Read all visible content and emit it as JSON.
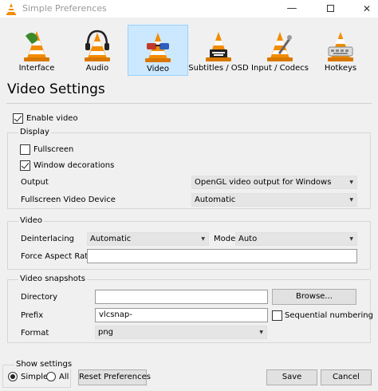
{
  "window": {
    "title": "Simple Preferences",
    "minimize": "—",
    "close": "✕"
  },
  "categories": [
    {
      "label": "Interface",
      "icon": "cone-interface-icon",
      "selected": false
    },
    {
      "label": "Audio",
      "icon": "cone-headphones-icon",
      "selected": false
    },
    {
      "label": "Video",
      "icon": "cone-glasses-icon",
      "selected": true
    },
    {
      "label": "Subtitles / OSD",
      "icon": "cone-subtitles-icon",
      "selected": false
    },
    {
      "label": "Input / Codecs",
      "icon": "cone-tools-icon",
      "selected": false
    },
    {
      "label": "Hotkeys",
      "icon": "cone-keyboard-icon",
      "selected": false
    }
  ],
  "page_title": "Video Settings",
  "enable_video": {
    "label": "Enable video",
    "checked": true
  },
  "display": {
    "title": "Display",
    "fullscreen": {
      "label": "Fullscreen",
      "checked": false
    },
    "window_decorations": {
      "label": "Window decorations",
      "checked": true
    },
    "output_label": "Output",
    "output_value": "OpenGL video output for Windows",
    "fs_device_label": "Fullscreen Video Device",
    "fs_device_value": "Automatic"
  },
  "video": {
    "title": "Video",
    "deinterlacing_label": "Deinterlacing",
    "deinterlacing_value": "Automatic",
    "mode_label": "Mode",
    "mode_value": "Auto",
    "aspect_label": "Force Aspect Ratio",
    "aspect_value": ""
  },
  "snapshots": {
    "title": "Video snapshots",
    "directory_label": "Directory",
    "directory_value": "",
    "browse_label": "Browse...",
    "prefix_label": "Prefix",
    "prefix_value": "vlcsnap-",
    "sequential": {
      "label": "Sequential numbering",
      "checked": false
    },
    "format_label": "Format",
    "format_value": "png"
  },
  "footer": {
    "show_settings_title": "Show settings",
    "simple_label": "Simple",
    "all_label": "All",
    "selected": "Simple",
    "reset_label": "Reset Preferences",
    "save_label": "Save",
    "cancel_label": "Cancel"
  },
  "colors": {
    "selected_bg": "#cce8ff",
    "cone_orange": "#f28c00",
    "window_bg": "#f0f0f0"
  }
}
